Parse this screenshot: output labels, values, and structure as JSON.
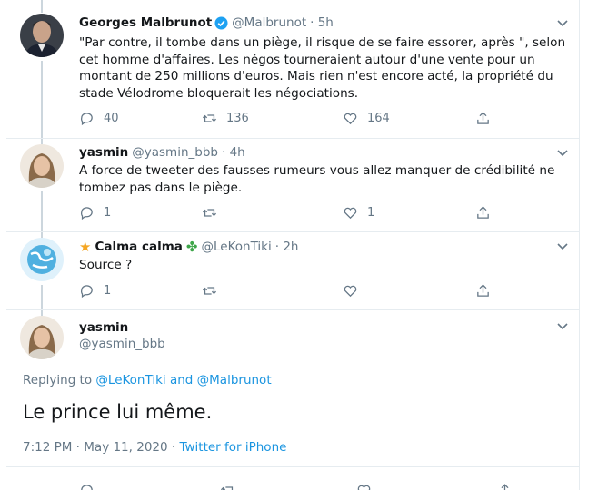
{
  "tweets": [
    {
      "name": "Georges Malbrunot",
      "handle": "@Malbrunot",
      "time": "· 5h",
      "verified": true,
      "text": "\"Par contre, il tombe dans un piège, il risque de se faire essorer, après \", selon cet homme d'affaires. Les négos tourneraient autour d'une vente pour un montant de 250 millions d'euros. Mais rien n'est encore acté, la propriété du stade Vélodrome bloquerait les négociations.",
      "replies": "40",
      "retweets": "136",
      "likes": "164"
    },
    {
      "name": "yasmin",
      "handle": "@yasmin_bbb",
      "time": "· 4h",
      "text": "A force de tweeter des fausses rumeurs vous allez manquer de crédibilité ne tombez pas dans le piège.",
      "replies": "1",
      "retweets": "",
      "likes": "1"
    },
    {
      "name": "Calma calma",
      "handle": "@LeKonTiki",
      "time": "· 2h",
      "text": "Source ?",
      "replies": "1",
      "retweets": "",
      "likes": ""
    }
  ],
  "focus": {
    "name": "yasmin",
    "handle": "@yasmin_bbb",
    "replying_prefix": "Replying to",
    "replying_to_1": "@LeKonTiki",
    "replying_and": "and",
    "replying_to_2": "@Malbrunot",
    "text": "Le prince lui même.",
    "timestamp": "7:12 PM · May 11, 2020 ·",
    "source": "Twitter for iPhone"
  },
  "icons": [
    "chevron-down-icon",
    "reply-icon",
    "retweet-icon",
    "like-icon",
    "share-icon",
    "verified-badge-icon",
    "star-icon",
    "clover-icon"
  ],
  "colors": {
    "link": "#1b95e0",
    "muted": "#657786",
    "verified": "#1da1f2"
  }
}
